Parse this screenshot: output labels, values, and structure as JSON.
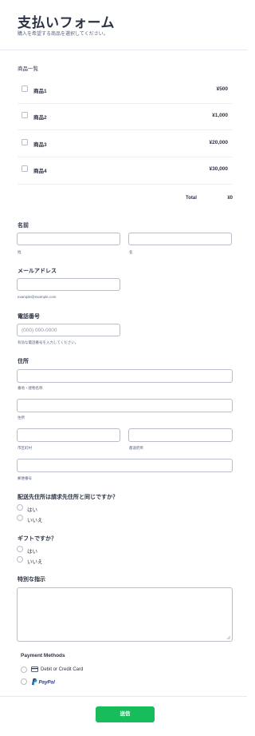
{
  "header": {
    "title": "支払いフォーム",
    "subtitle": "購入を希望する商品を選択してください。"
  },
  "products": {
    "label": "商品一覧",
    "items": [
      {
        "name": "商品1",
        "price": "¥500"
      },
      {
        "name": "商品2",
        "price": "¥1,000"
      },
      {
        "name": "商品3",
        "price": "¥20,000"
      },
      {
        "name": "商品4",
        "price": "¥30,000"
      }
    ],
    "total_label": "Total",
    "total_value": "¥0"
  },
  "name_field": {
    "label": "名前",
    "first_sublabel": "姓",
    "last_sublabel": "名"
  },
  "email_field": {
    "label": "メールアドレス",
    "sublabel": "example@example.com"
  },
  "phone_field": {
    "label": "電話番号",
    "placeholder": "(000) 000-0000",
    "sublabel": "有効な電話番号を入力してください。"
  },
  "address_field": {
    "label": "住所",
    "street1_sublabel": "番地・建物名称",
    "street2_sublabel": "住所",
    "city_sublabel": "市区町村",
    "state_sublabel": "都道府県",
    "postal_sublabel": "郵便番号"
  },
  "shipping_question": {
    "label": "配送先住所は請求先住所と同じですか？",
    "options": [
      "はい",
      "いいえ"
    ]
  },
  "gift_question": {
    "label": "ギフトですか？",
    "options": [
      "はい",
      "いいえ"
    ]
  },
  "instructions": {
    "label": "特別な指示"
  },
  "payment": {
    "label": "Payment Methods",
    "options": [
      "Debit or Credit Card",
      "PayPal"
    ]
  },
  "submit": {
    "label": "送信"
  },
  "colors": {
    "accent": "#18bd5b",
    "text": "#2c3345",
    "border": "#b8bdc9",
    "paypal_dark": "#253b80",
    "paypal_light": "#179bd7"
  },
  "icons": {
    "card": "credit-card-icon",
    "paypal": "paypal-logo-icon",
    "resize": "resize-handle-icon"
  }
}
